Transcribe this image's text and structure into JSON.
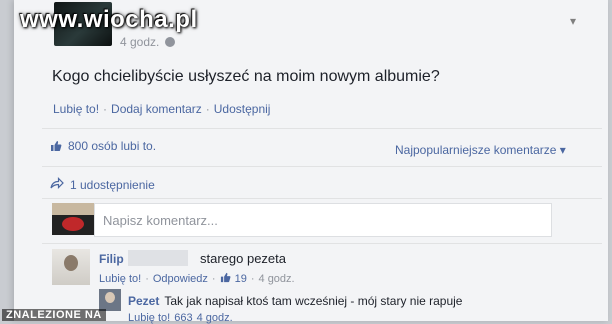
{
  "site": {
    "watermark": "www.wiocha.pl",
    "footer_mark": "ZNALEZIONE NA"
  },
  "post": {
    "time": "4 godz.",
    "text": "Kogo chcielibyście usłyszeć na moim nowym albumie?",
    "actions": {
      "like": "Lubię to!",
      "comment": "Dodaj komentarz",
      "share": "Udostępnij",
      "separator": "·"
    }
  },
  "stats": {
    "likes": "800 osób lubi to.",
    "sort": "Najpopularniejsze komentarze ▾",
    "shares": "1 udostępnienie"
  },
  "comment_box": {
    "placeholder": "Napisz komentarz..."
  },
  "comments": [
    {
      "author": "Filip",
      "text": "starego pezeta",
      "like": "Lubię to!",
      "reply": "Odpowiedz",
      "likes": "19",
      "time": "4 godz.",
      "reply_thread": {
        "author": "Pezet",
        "text": "Tak jak napisał ktoś tam wcześniej - mój stary nie rapuje",
        "like": "Lubię to!",
        "likes": "663",
        "time": "4 godz."
      }
    }
  ],
  "colors": {
    "link": "#4b67a1",
    "muted": "#90949c",
    "text": "#1d2129",
    "background": "#f3f4f6"
  },
  "icons": [
    "thumbs-up-icon",
    "share-arrow-icon",
    "globe-icon",
    "chevron-down-icon"
  ]
}
